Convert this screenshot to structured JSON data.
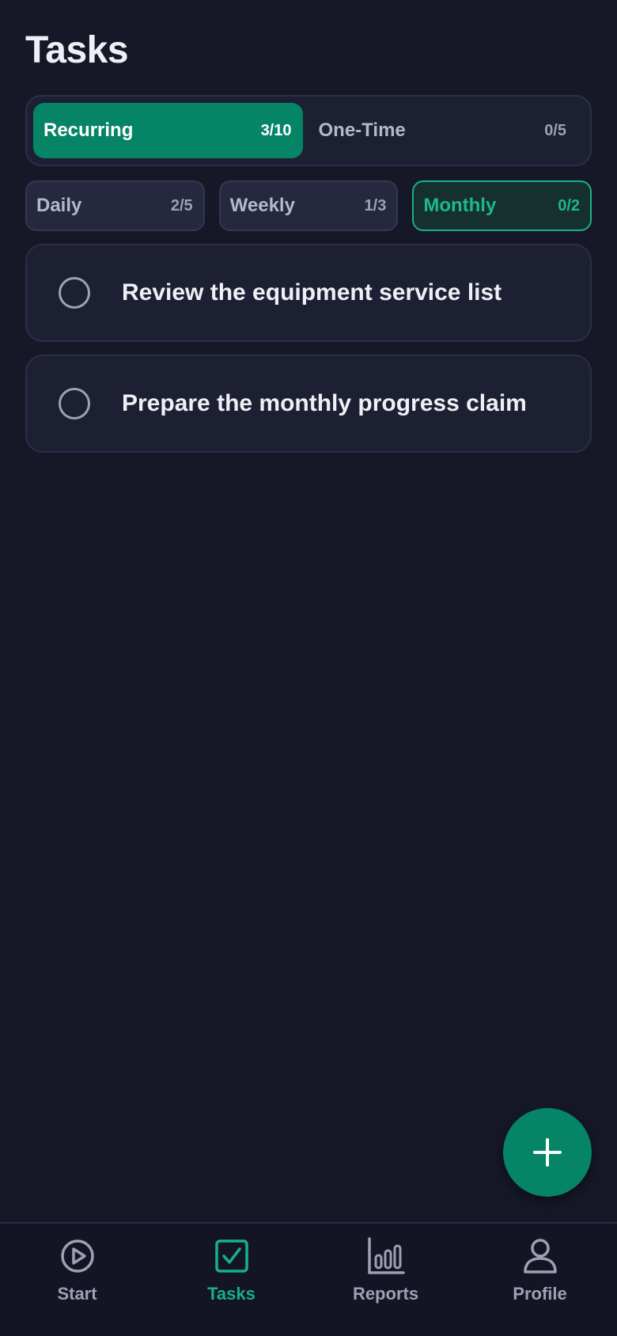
{
  "header": {
    "title": "Tasks"
  },
  "segment": {
    "tabs": [
      {
        "label": "Recurring",
        "count": "3/10",
        "active": true
      },
      {
        "label": "One-Time",
        "count": "0/5",
        "active": false
      }
    ]
  },
  "filters": {
    "chips": [
      {
        "label": "Daily",
        "count": "2/5",
        "active": false
      },
      {
        "label": "Weekly",
        "count": "1/3",
        "active": false
      },
      {
        "label": "Monthly",
        "count": "0/2",
        "active": true
      }
    ]
  },
  "tasks": [
    {
      "text": "Review the equipment service list",
      "done": false
    },
    {
      "text": "Prepare the monthly progress claim",
      "done": false
    }
  ],
  "fab": {
    "icon": "plus-icon"
  },
  "nav": {
    "items": [
      {
        "label": "Start",
        "icon": "play-circle-icon",
        "active": false
      },
      {
        "label": "Tasks",
        "icon": "checkbox-icon",
        "active": true
      },
      {
        "label": "Reports",
        "icon": "bar-chart-icon",
        "active": false
      },
      {
        "label": "Profile",
        "icon": "user-icon",
        "active": false
      }
    ]
  },
  "colors": {
    "background": "#161828",
    "accent": "#068466",
    "accent_text": "#17b08a",
    "card": "#1d1f33",
    "muted_text": "#9da1b4"
  }
}
